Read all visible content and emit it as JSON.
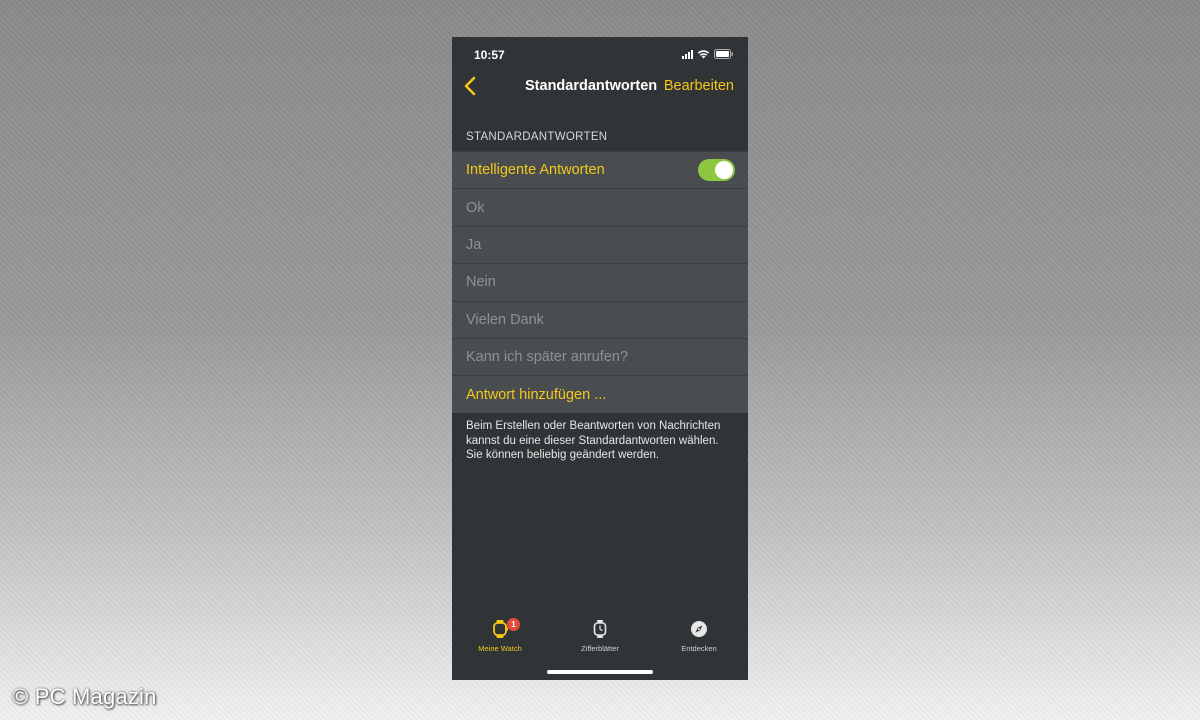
{
  "status_bar": {
    "time": "10:57"
  },
  "navbar": {
    "title": "Standardantworten",
    "edit_label": "Bearbeiten"
  },
  "section_header": "STANDARDANTWORTEN",
  "smart_replies": {
    "label": "Intelligente Antworten",
    "enabled": true
  },
  "replies": [
    "Ok",
    "Ja",
    "Nein",
    "Vielen Dank",
    "Kann ich später anrufen?"
  ],
  "add_reply_label": "Antwort hinzufügen ...",
  "footer_text": "Beim Erstellen oder Beantworten von Nachrichten kannst du eine dieser Standardantworten wählen. Sie können beliebig geändert werden.",
  "tabs": [
    {
      "label": "Meine Watch",
      "icon": "watch-icon",
      "active": true,
      "badge": "1"
    },
    {
      "label": "Zifferblätter",
      "icon": "watch-face-icon",
      "active": false
    },
    {
      "label": "Entdecken",
      "icon": "compass-icon",
      "active": false
    }
  ],
  "copyright": "© PC Magazin",
  "colors": {
    "accent": "#f3c81a",
    "toggle_on": "#8dc63f",
    "background": "#313436",
    "cell": "#4a4d50",
    "badge": "#e24a3b"
  }
}
